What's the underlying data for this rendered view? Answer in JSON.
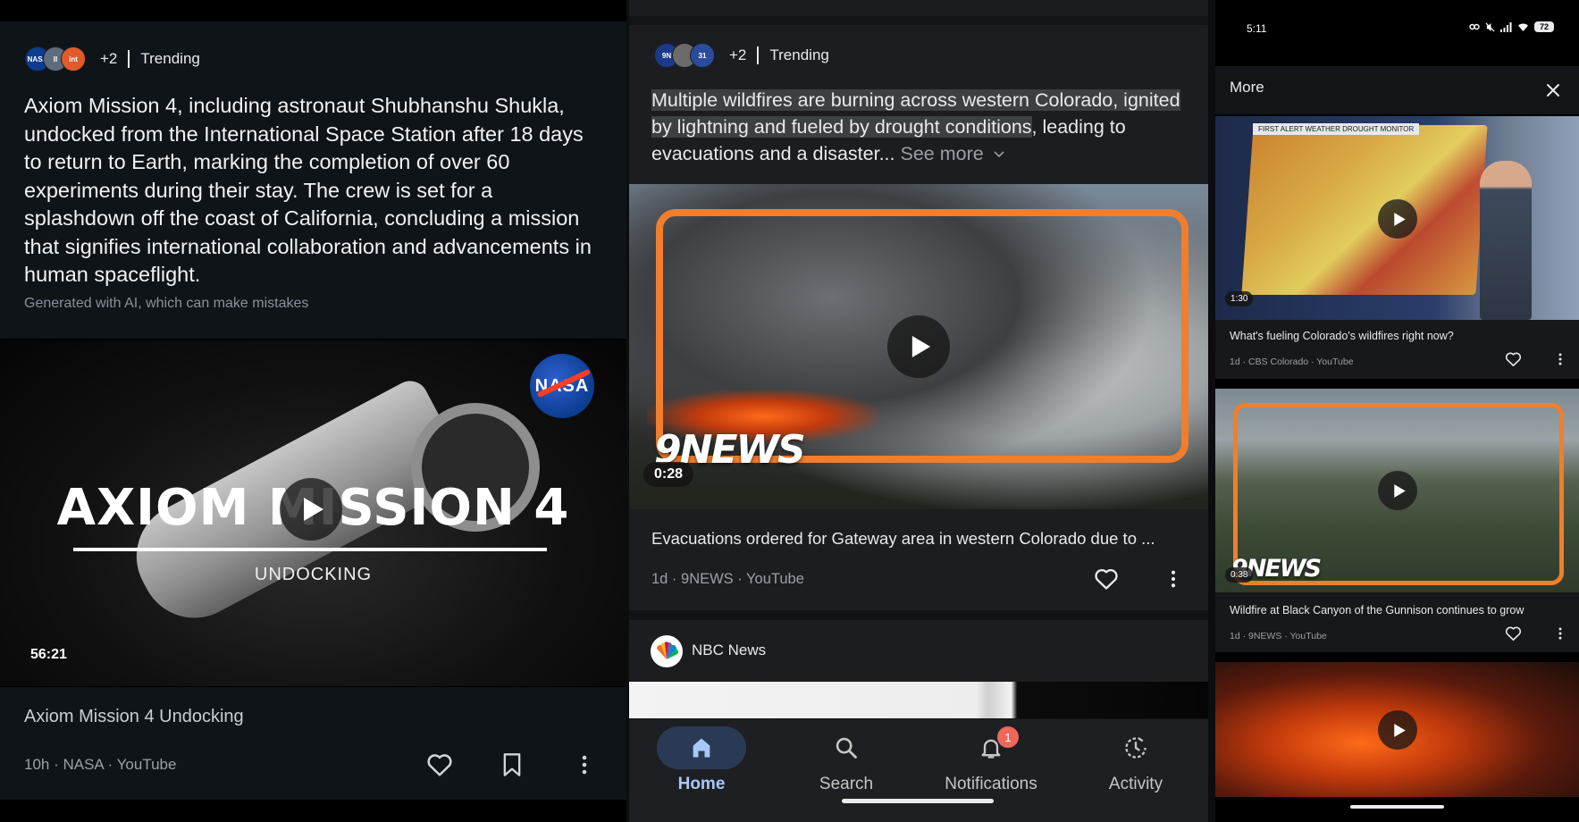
{
  "panel1": {
    "source": {
      "avatars": [
        "NASA",
        "II",
        "int"
      ],
      "extra_count": "+2",
      "label": "Trending"
    },
    "summary": "Axiom Mission 4, including astronaut Shubhanshu Shukla, undocked from the International Space Station after 18 days to return to Earth, marking the completion of over 60 experiments during their stay. The crew is set for a splashdown off the coast of California, concluding a mission that signifies international collaboration and advancements in human spaceflight.",
    "ai_note": "Generated with AI, which can make mistakes",
    "video": {
      "logo_text": "NASA",
      "title_overlay": "AXIOM MISSION 4",
      "subtitle_overlay": "UNDOCKING",
      "duration": "56:21",
      "title": "Axiom Mission 4 Undocking",
      "meta": "10h · NASA · YouTube"
    },
    "icons": {
      "like": "heart-icon",
      "save": "bookmark-icon",
      "more": "more-vert-icon"
    }
  },
  "panel2": {
    "source": {
      "avatars": [
        "9N",
        "",
        "31"
      ],
      "extra_count": "+2",
      "label": "Trending"
    },
    "summary": {
      "highlighted": "Multiple wildfires are burning across western Colorado, ignited by lightning and fueled by drought conditions",
      "rest": ", leading to evacuations and a disaster...",
      "see_more": "See more"
    },
    "video": {
      "news_logo": "9NEWS",
      "duration": "0:28",
      "title": "Evacuations ordered for Gateway area in western Colorado due to ...",
      "meta": "1d · 9NEWS · YouTube"
    },
    "next_source": {
      "name": "NBC News"
    },
    "nav": {
      "items": [
        {
          "label": "Home",
          "icon": "home-icon",
          "active": true
        },
        {
          "label": "Search",
          "icon": "search-icon",
          "active": false
        },
        {
          "label": "Notifications",
          "icon": "bell-icon",
          "active": false,
          "badge": "1"
        },
        {
          "label": "Activity",
          "icon": "activity-icon",
          "active": false
        }
      ]
    }
  },
  "panel3": {
    "status": {
      "time": "5:11",
      "battery": "72"
    },
    "header": {
      "title": "More"
    },
    "cards": [
      {
        "duration": "1:30",
        "title": "What's fueling Colorado's wildfires right now?",
        "meta": "1d · CBS Colorado · YouTube",
        "overlay_text": "FIRST ALERT WEATHER   DROUGHT MONITOR"
      },
      {
        "duration": "0:38",
        "title": "Wildfire at Black Canyon of the Gunnison continues to grow",
        "meta": "1d · 9NEWS · YouTube",
        "overlay_text": "9NEWS"
      },
      {
        "duration": "",
        "title": "",
        "meta": ""
      }
    ]
  },
  "colors": {
    "accent_orange": "#f07e2c",
    "nav_active_bg": "#2a3a55",
    "nav_active_text": "#a8c7fa",
    "badge": "#ee675c",
    "nasa_blue": "#0b3d91"
  }
}
